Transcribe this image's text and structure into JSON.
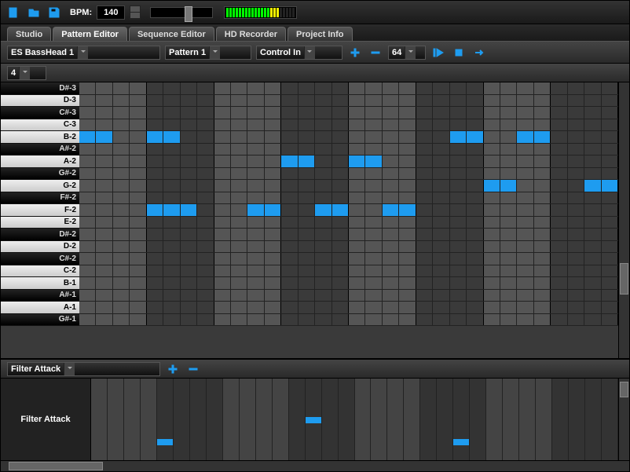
{
  "topbar": {
    "bpm_label": "BPM:",
    "bpm_value": "140"
  },
  "meter_levels": [
    "#0f0",
    "#0f0",
    "#0f0",
    "#0f0",
    "#0f0",
    "#0f0",
    "#0f0",
    "#0f0",
    "#0f0",
    "#0f0",
    "#0f0",
    "#0f0",
    "#0f0",
    "#0f0",
    "#ff0",
    "#ff0",
    "#ff0",
    "#222",
    "#222",
    "#222",
    "#222",
    "#222"
  ],
  "tabs": [
    "Studio",
    "Pattern Editor",
    "Sequence Editor",
    "HD Recorder",
    "Project Info"
  ],
  "active_tab": 1,
  "toolbar": {
    "instrument": "ES BassHead 1",
    "pattern": "Pattern 1",
    "control": "Control In",
    "steps": "64"
  },
  "subbar": {
    "zoom": "4"
  },
  "piano_keys": [
    {
      "n": "D#-3",
      "b": 1
    },
    {
      "n": "D-3",
      "b": 0
    },
    {
      "n": "C#-3",
      "b": 1
    },
    {
      "n": "C-3",
      "b": 0
    },
    {
      "n": "B-2",
      "b": 0
    },
    {
      "n": "A#-2",
      "b": 1
    },
    {
      "n": "A-2",
      "b": 0
    },
    {
      "n": "G#-2",
      "b": 1
    },
    {
      "n": "G-2",
      "b": 0
    },
    {
      "n": "F#-2",
      "b": 1
    },
    {
      "n": "F-2",
      "b": 0
    },
    {
      "n": "E-2",
      "b": 0
    },
    {
      "n": "D#-2",
      "b": 1
    },
    {
      "n": "D-2",
      "b": 0
    },
    {
      "n": "C#-2",
      "b": 1
    },
    {
      "n": "C-2",
      "b": 0
    },
    {
      "n": "B-1",
      "b": 0
    },
    {
      "n": "A#-1",
      "b": 1
    },
    {
      "n": "A-1",
      "b": 0
    },
    {
      "n": "G#-1",
      "b": 1
    }
  ],
  "steps_count": 32,
  "notes": [
    {
      "row": 4,
      "start": 0,
      "len": 2
    },
    {
      "row": 4,
      "start": 4,
      "len": 2
    },
    {
      "row": 4,
      "start": 22,
      "len": 2
    },
    {
      "row": 4,
      "start": 26,
      "len": 2
    },
    {
      "row": 6,
      "start": 12,
      "len": 2
    },
    {
      "row": 6,
      "start": 16,
      "len": 2
    },
    {
      "row": 8,
      "start": 24,
      "len": 2
    },
    {
      "row": 8,
      "start": 30,
      "len": 2
    },
    {
      "row": 10,
      "start": 4,
      "len": 3
    },
    {
      "row": 10,
      "start": 10,
      "len": 2
    },
    {
      "row": 10,
      "start": 14,
      "len": 2
    },
    {
      "row": 10,
      "start": 18,
      "len": 2
    }
  ],
  "control": {
    "name": "Filter Attack",
    "label": "Filter Attack",
    "values": [
      0,
      0,
      0,
      0,
      18,
      0,
      0,
      0,
      0,
      0,
      0,
      0,
      0,
      45,
      0,
      0,
      0,
      0,
      0,
      0,
      0,
      0,
      18,
      0,
      0,
      0,
      0,
      0,
      0,
      0,
      0,
      0
    ]
  }
}
